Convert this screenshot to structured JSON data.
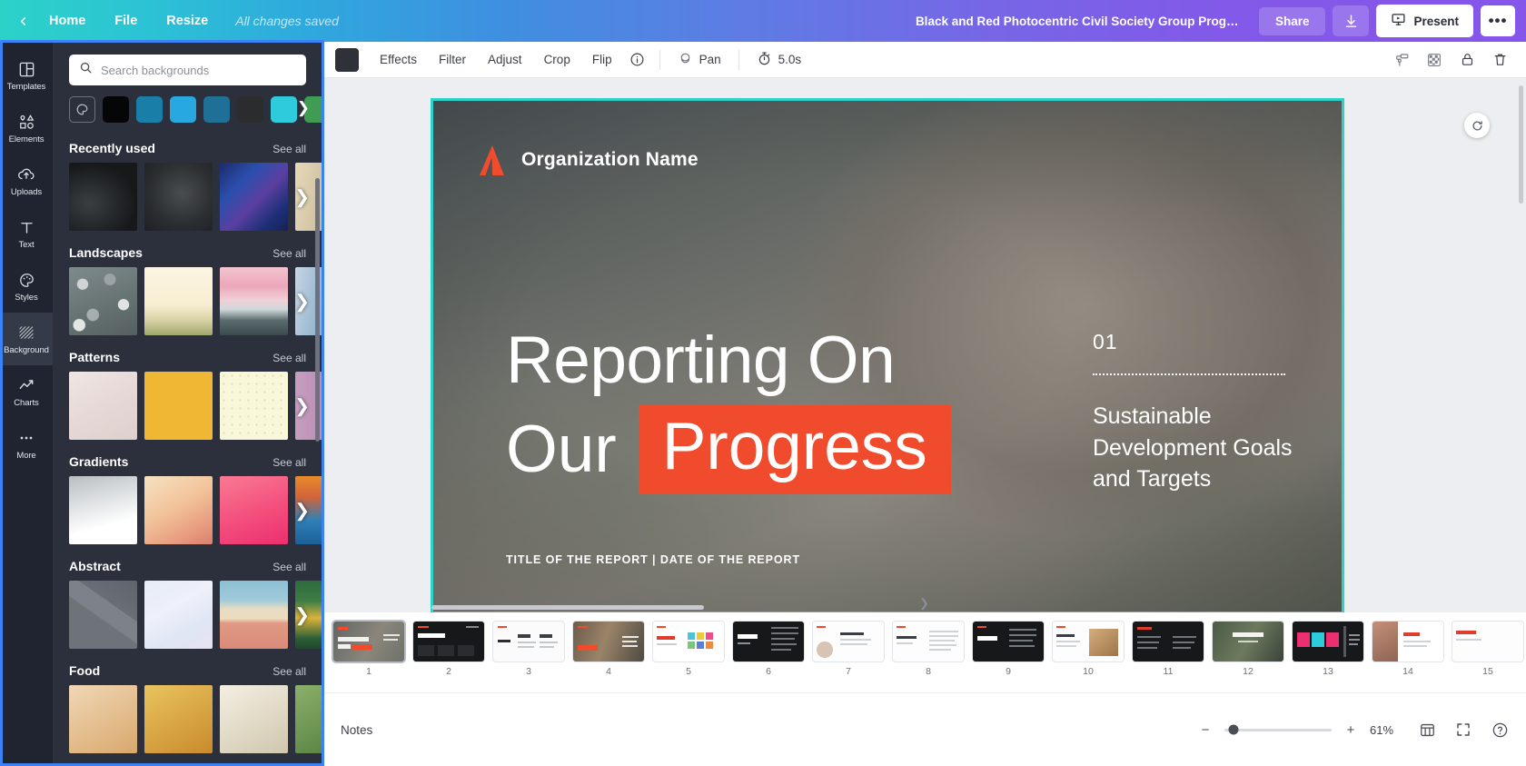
{
  "header": {
    "back_icon": "chevron-left-icon",
    "items": [
      {
        "label": "Home",
        "name": "home"
      },
      {
        "label": "File",
        "name": "file"
      },
      {
        "label": "Resize",
        "name": "resize"
      }
    ],
    "save_status": "All changes saved",
    "doc_title": "Black and Red Photocentric Civil Society Group Progress Re...",
    "share_label": "Share",
    "download_icon": "download-icon",
    "present_label": "Present",
    "present_icon": "present-screen-icon",
    "more_label": "•••",
    "gradient_start": "#2cd2c8",
    "gradient_end": "#8655ea"
  },
  "rail": {
    "items": [
      {
        "label": "Templates",
        "icon": "templates-icon",
        "active": false
      },
      {
        "label": "Elements",
        "icon": "elements-icon",
        "active": false
      },
      {
        "label": "Uploads",
        "icon": "uploads-icon",
        "active": false
      },
      {
        "label": "Text",
        "icon": "text-icon",
        "active": false
      },
      {
        "label": "Styles",
        "icon": "styles-palette-icon",
        "active": false
      },
      {
        "label": "Background",
        "icon": "background-hatch-icon",
        "active": true
      },
      {
        "label": "Charts",
        "icon": "charts-line-icon",
        "active": false
      },
      {
        "label": "More",
        "icon": "more-dots-icon",
        "active": false
      }
    ]
  },
  "panel": {
    "search": {
      "placeholder": "Search backgrounds",
      "value": "",
      "icon": "search-icon"
    },
    "swatches": [
      {
        "name": "color-picker",
        "color": ""
      },
      {
        "name": "swatch-black",
        "color": "#060608"
      },
      {
        "name": "swatch-teal-dark",
        "color": "#1a7fa8"
      },
      {
        "name": "swatch-blue-bright",
        "color": "#27a8e0"
      },
      {
        "name": "swatch-blue-steel",
        "color": "#1f6f96"
      },
      {
        "name": "swatch-charcoal",
        "color": "#2a2c2e"
      },
      {
        "name": "swatch-cyan",
        "color": "#2ecbdc"
      },
      {
        "name": "swatch-green",
        "color": "#3f9c52"
      }
    ],
    "swatch_arrow": "chevron-right-icon",
    "see_all": "See all",
    "sections": [
      {
        "title": "Recently used",
        "thumbs": [
          {
            "name": "thumb-dark-texture",
            "style": "dark-rock"
          },
          {
            "name": "thumb-grey-smoke",
            "style": "grey-smoke"
          },
          {
            "name": "thumb-blue-confetti",
            "style": "blue-confetti"
          },
          {
            "name": "thumb-cream-edge",
            "style": "cream-edge"
          }
        ]
      },
      {
        "title": "Landscapes",
        "thumbs": [
          {
            "name": "thumb-pebbles",
            "style": "pebbles"
          },
          {
            "name": "thumb-field-cream",
            "style": "field-cream"
          },
          {
            "name": "thumb-pink-mountains",
            "style": "pink-mountains"
          },
          {
            "name": "thumb-blue-fade",
            "style": "blue-fade"
          }
        ]
      },
      {
        "title": "Patterns",
        "thumbs": [
          {
            "name": "thumb-blush-paper",
            "style": "blush-paper"
          },
          {
            "name": "thumb-mustard",
            "style": "mustard"
          },
          {
            "name": "thumb-cream-dots",
            "style": "cream-dots"
          },
          {
            "name": "thumb-mauve-stripe",
            "style": "mauve-stripe"
          }
        ]
      },
      {
        "title": "Gradients",
        "thumbs": [
          {
            "name": "thumb-grey-white",
            "style": "grey-white"
          },
          {
            "name": "thumb-peach",
            "style": "peach"
          },
          {
            "name": "thumb-pink-hot",
            "style": "pink-hot"
          },
          {
            "name": "thumb-orange-blue",
            "style": "orange-blue"
          }
        ]
      },
      {
        "title": "Abstract",
        "thumbs": [
          {
            "name": "thumb-grey-facets",
            "style": "grey-facets"
          },
          {
            "name": "thumb-lavender-mist",
            "style": "lavender-mist"
          },
          {
            "name": "thumb-desert-sky",
            "style": "desert-sky"
          },
          {
            "name": "thumb-green-strip",
            "style": "green-strip"
          }
        ]
      },
      {
        "title": "Food",
        "thumbs": []
      }
    ]
  },
  "toolbar": {
    "color_swatch": "#2f3138",
    "buttons": [
      "Effects",
      "Filter",
      "Adjust",
      "Crop",
      "Flip"
    ],
    "info_icon": "info-circle-icon",
    "pan_label": "Pan",
    "pan_icon": "pan-hand-icon",
    "timer_value": "5.0s",
    "timer_icon": "stopwatch-icon",
    "right_icons": [
      {
        "name": "paint-roller-icon"
      },
      {
        "name": "transparency-grid-icon"
      },
      {
        "name": "lock-icon"
      },
      {
        "name": "trash-icon"
      }
    ]
  },
  "slide": {
    "org_name": "Organization Name",
    "logo_icon": "org-logo-icon",
    "logo_color": "#f04b2d",
    "title_line1": "Reporting On",
    "title_line2_plain": "Our",
    "title_line2_highlight": "Progress",
    "highlight_color": "#f04b2d",
    "section_number": "01",
    "section_text": "Sustainable Development Goals and Targets",
    "footer": "TITLE OF THE REPORT  |  DATE OF THE REPORT",
    "rotate_icon": "rotate-handle-icon",
    "selection_color": "#2cd2c8"
  },
  "filmstrip": {
    "slides": [
      {
        "n": "1",
        "style": "s1",
        "selected": true
      },
      {
        "n": "2",
        "style": "s2",
        "selected": false
      },
      {
        "n": "3",
        "style": "s3",
        "selected": false
      },
      {
        "n": "4",
        "style": "s4",
        "selected": false
      },
      {
        "n": "5",
        "style": "s5",
        "selected": false
      },
      {
        "n": "6",
        "style": "s6",
        "selected": false
      },
      {
        "n": "7",
        "style": "s7",
        "selected": false
      },
      {
        "n": "8",
        "style": "s8",
        "selected": false
      },
      {
        "n": "9",
        "style": "s9",
        "selected": false
      },
      {
        "n": "10",
        "style": "s10",
        "selected": false
      },
      {
        "n": "11",
        "style": "s11",
        "selected": false
      },
      {
        "n": "12",
        "style": "s12",
        "selected": false
      },
      {
        "n": "13",
        "style": "s13",
        "selected": false
      },
      {
        "n": "14",
        "style": "s14",
        "selected": false
      },
      {
        "n": "15",
        "style": "s15",
        "selected": false
      }
    ]
  },
  "status": {
    "notes_label": "Notes",
    "zoom_minus": "−",
    "zoom_plus": "+",
    "zoom_percent": "61%",
    "grid_icon": "grid-view-icon",
    "fullscreen_icon": "fullscreen-icon",
    "help_icon": "help-circle-icon"
  }
}
